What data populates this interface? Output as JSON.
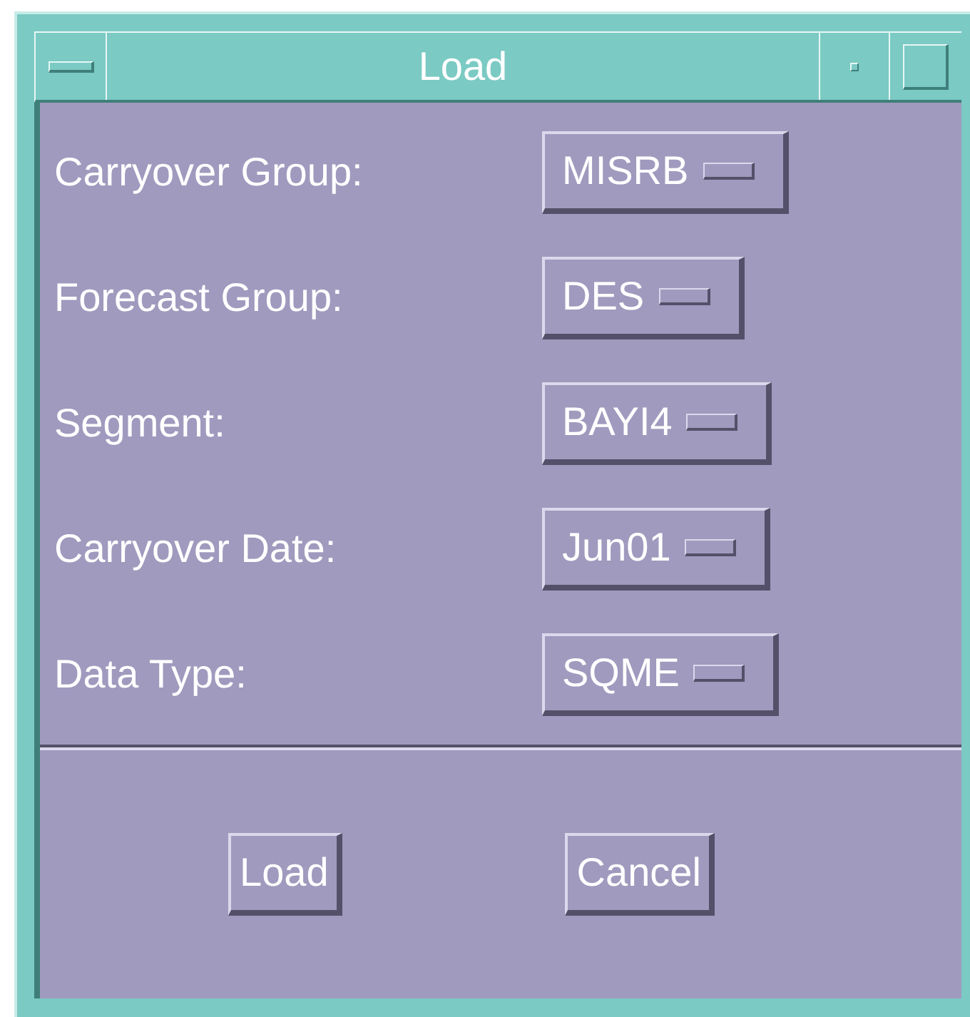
{
  "window": {
    "title": "Load"
  },
  "fields": [
    {
      "label": "Carryover Group:",
      "value": "MISRB"
    },
    {
      "label": "Forecast Group:",
      "value": "DES"
    },
    {
      "label": "Segment:",
      "value": "BAYI4"
    },
    {
      "label": "Carryover Date:",
      "value": "Jun01"
    },
    {
      "label": "Data Type:",
      "value": "SQME"
    }
  ],
  "buttons": [
    "Load",
    "Cancel"
  ]
}
